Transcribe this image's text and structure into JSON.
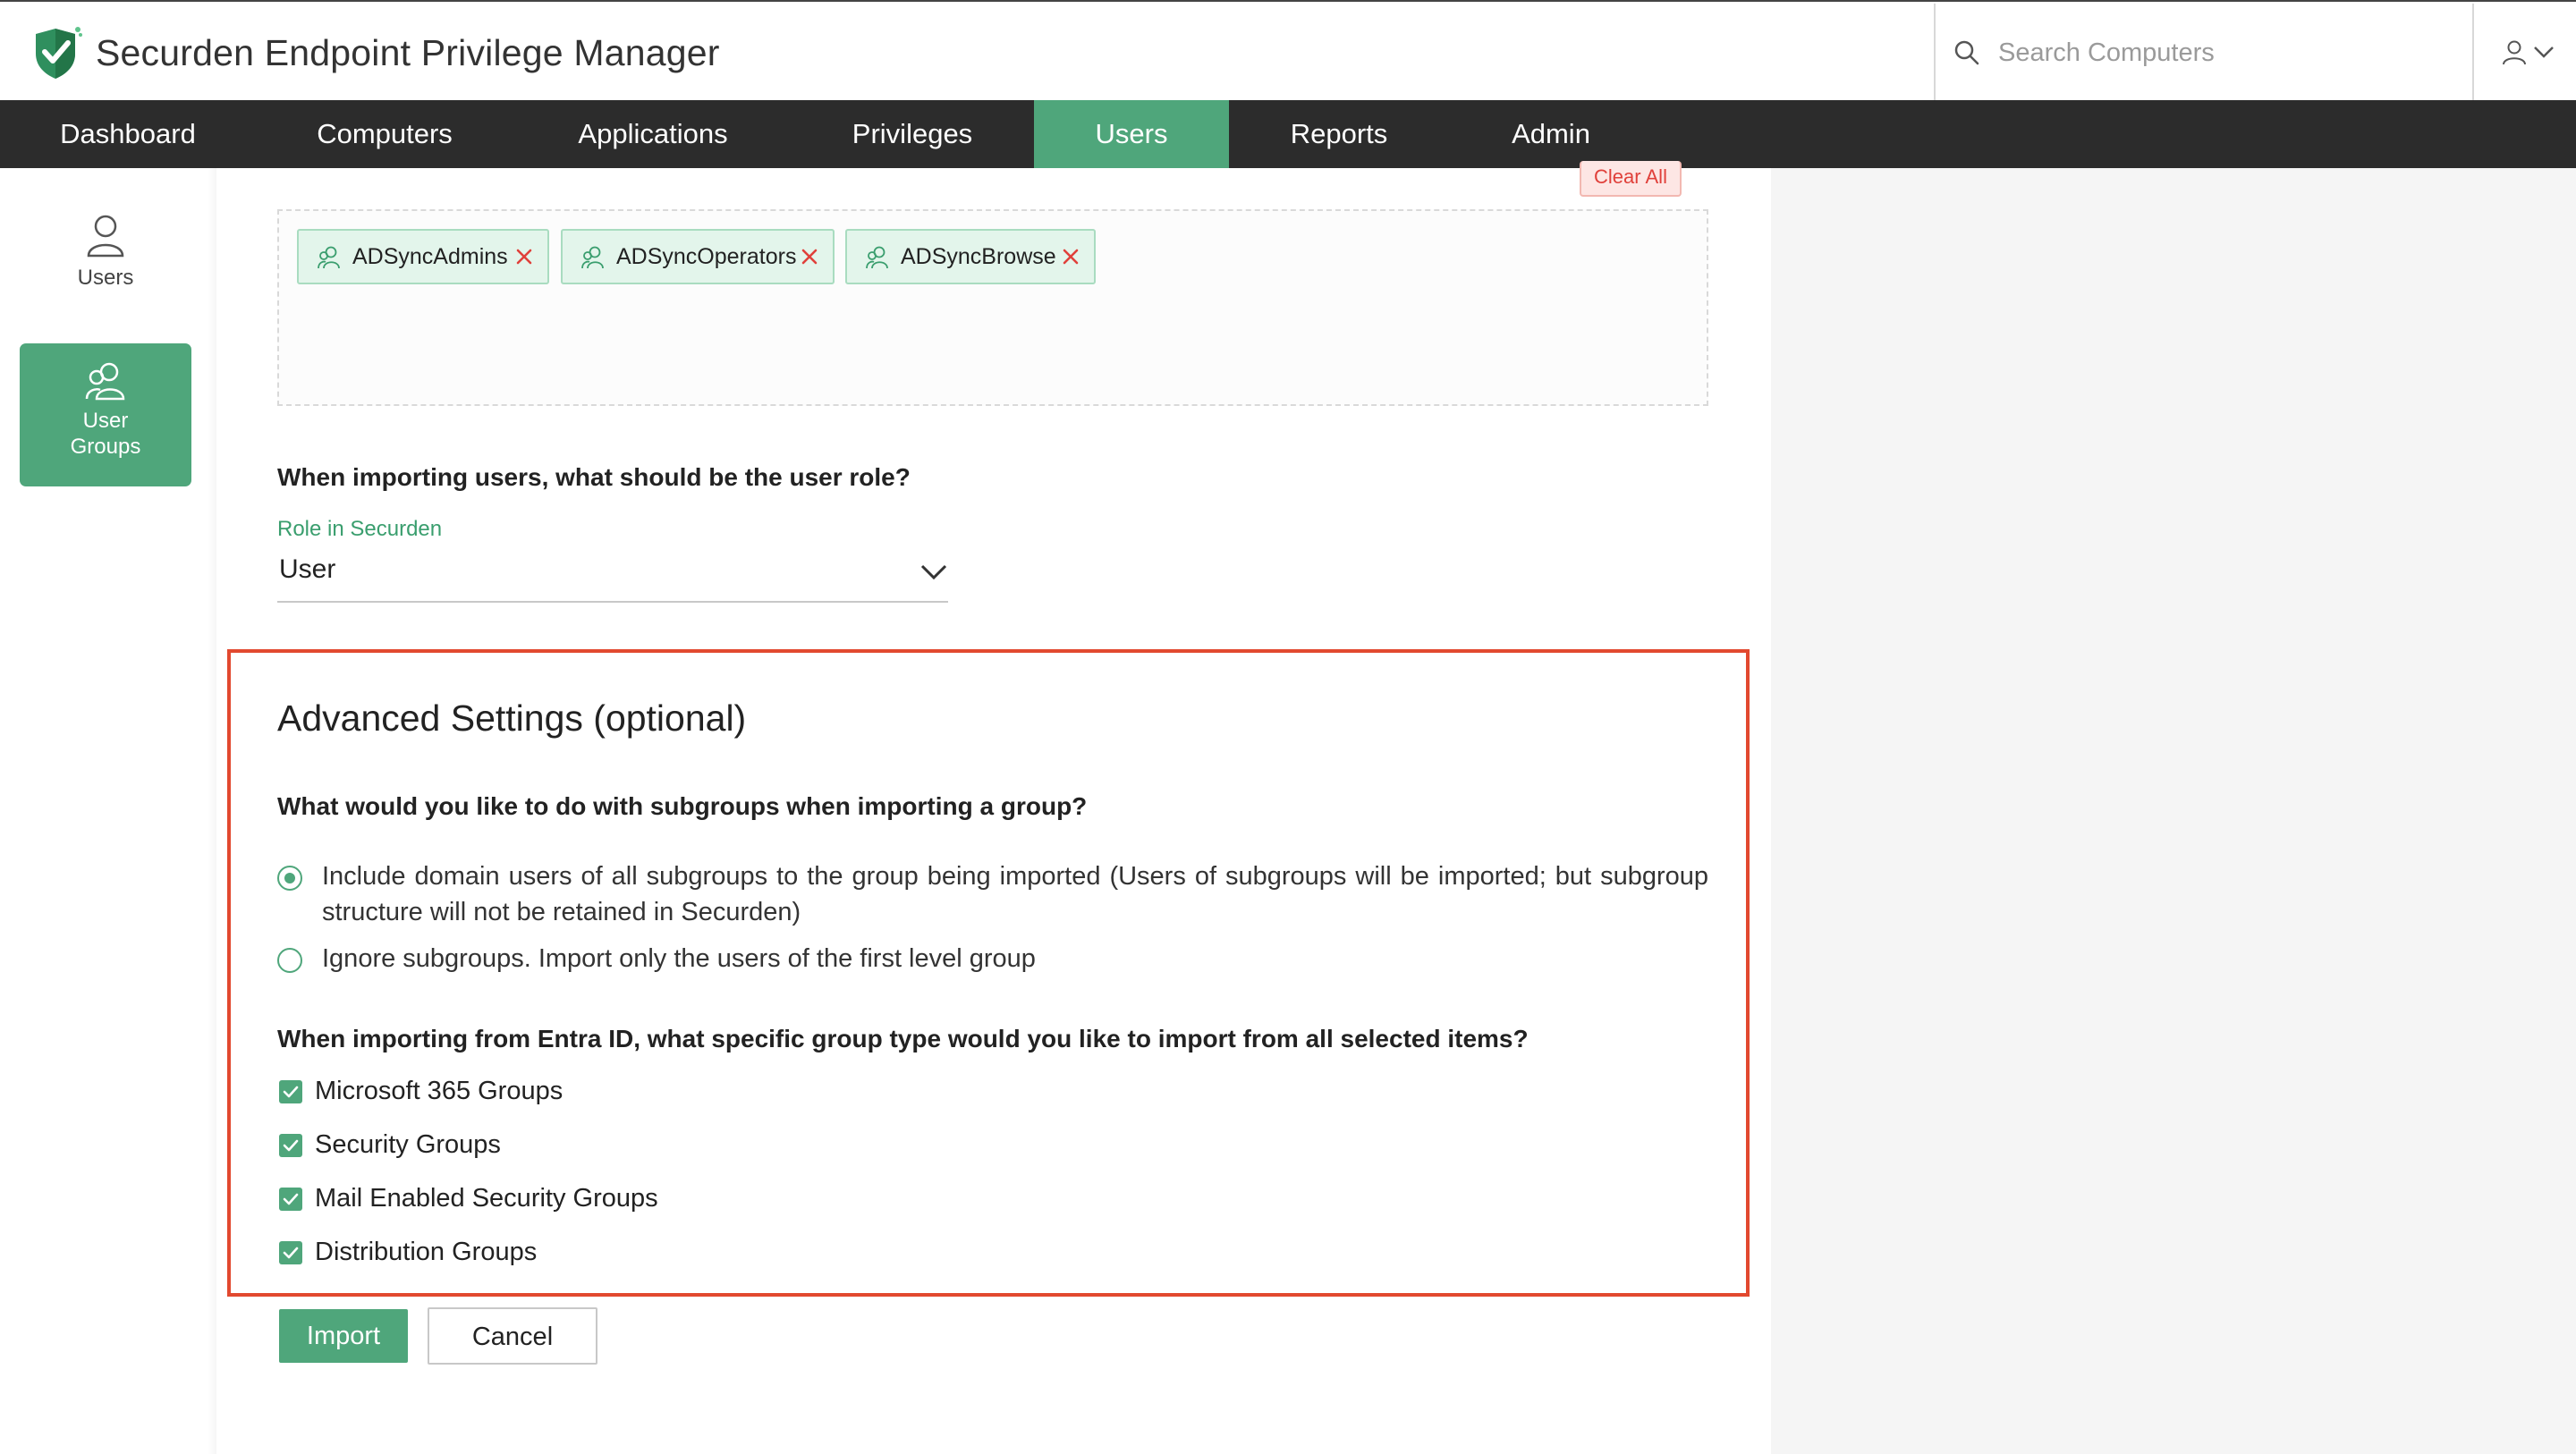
{
  "app": {
    "title": "Securden Endpoint Privilege Manager"
  },
  "search": {
    "placeholder": "Search Computers",
    "value": ""
  },
  "nav": {
    "items": [
      {
        "label": "Dashboard"
      },
      {
        "label": "Computers"
      },
      {
        "label": "Applications"
      },
      {
        "label": "Privileges"
      },
      {
        "label": "Users",
        "active": true
      },
      {
        "label": "Reports"
      },
      {
        "label": "Admin"
      }
    ]
  },
  "sidebar": {
    "items": [
      {
        "label": "Users",
        "icon": "user-icon"
      },
      {
        "label": "User Groups",
        "icon": "user-group-icon",
        "active": true
      }
    ]
  },
  "selected_groups": {
    "clear_all_label": "Clear All",
    "chips": [
      {
        "label": "ADSyncAdmins",
        "icon": "user-group-icon"
      },
      {
        "label": "ADSyncOperators",
        "icon": "user-group-icon"
      },
      {
        "label": "ADSyncBrowse",
        "icon": "user-group-icon"
      }
    ]
  },
  "role": {
    "question": "When importing users, what should be the user role?",
    "field_label": "Role in Securden",
    "value": "User"
  },
  "advanced": {
    "title": "Advanced Settings (optional)",
    "subgroups_question": "What would you like to do with subgroups when importing a group?",
    "subgroup_options": [
      {
        "label": "Include domain users of all subgroups to the group being imported (Users of subgroups will be imported; but subgroup structure will not be retained in Securden)",
        "checked": true
      },
      {
        "label": "Ignore subgroups. Import only the users of the first level group",
        "checked": false
      }
    ],
    "entra_question": "When importing from Entra ID, what specific group type would you like to import from all selected items?",
    "group_types": [
      {
        "label": "Microsoft 365 Groups",
        "checked": true
      },
      {
        "label": "Security Groups",
        "checked": true
      },
      {
        "label": "Mail Enabled Security Groups",
        "checked": true
      },
      {
        "label": "Distribution Groups",
        "checked": true
      }
    ]
  },
  "actions": {
    "import_label": "Import",
    "cancel_label": "Cancel"
  },
  "colors": {
    "accent": "#4fa67b",
    "nav_bg": "#2c2c2c",
    "highlight_border": "#e2492f",
    "remove": "#e0403a"
  }
}
